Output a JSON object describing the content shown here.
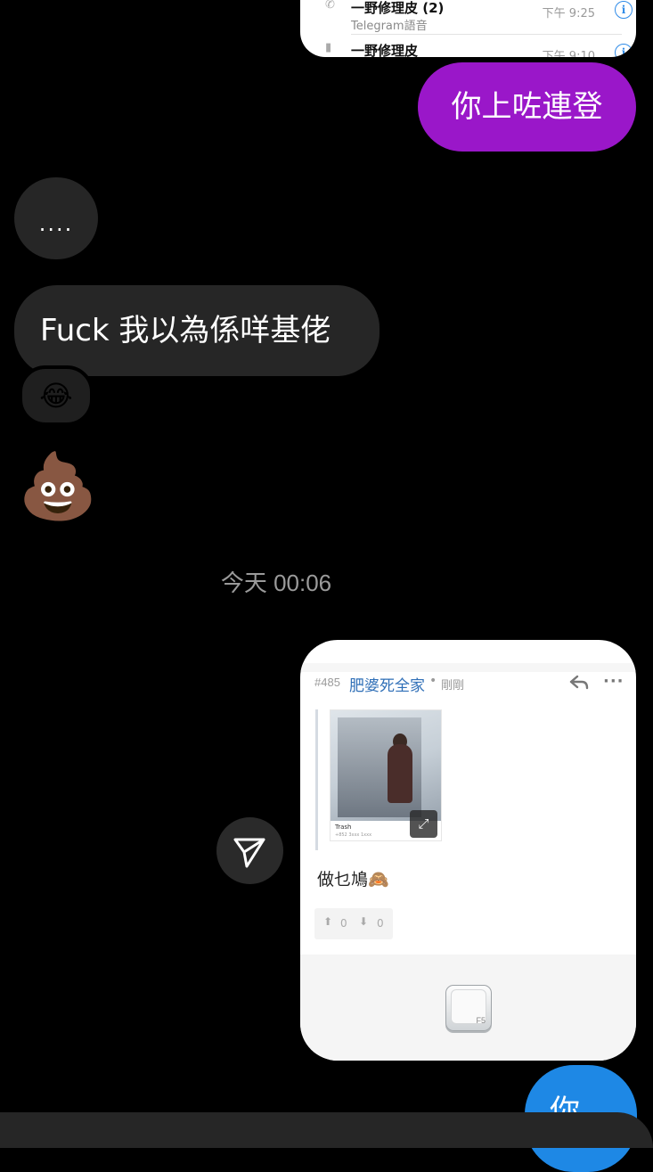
{
  "call_log": [
    {
      "name": "一野修理皮 (2)",
      "subtitle": "Telegram語音",
      "time": "下午 9:25",
      "icon": "phone-icon"
    },
    {
      "name": "一野修理皮",
      "time": "下午 9:10",
      "icon": "video-icon"
    }
  ],
  "messages": {
    "out_1": "你上咗連登",
    "in_1": "....",
    "in_2": "Fuck 我以為係咩基佬",
    "reaction": "😂",
    "in_3": "💩",
    "timestamp": "今天 00:06",
    "out_last": "你"
  },
  "forum_post": {
    "post_id": "#485",
    "author": "肥婆死全家",
    "dot": "•",
    "time": "剛剛",
    "thumbnail_caption": "Trash",
    "thumbnail_phone": "+852 3xxx 1xxx",
    "text": "做乜鳩🙈",
    "upvotes": "0",
    "downvotes": "0",
    "key_label": "F5"
  },
  "colors": {
    "outgoing_purple": "#9a17c9",
    "incoming_gray": "#262626",
    "outgoing_blue": "#1e88e5",
    "author_link": "#2f6fb7"
  }
}
